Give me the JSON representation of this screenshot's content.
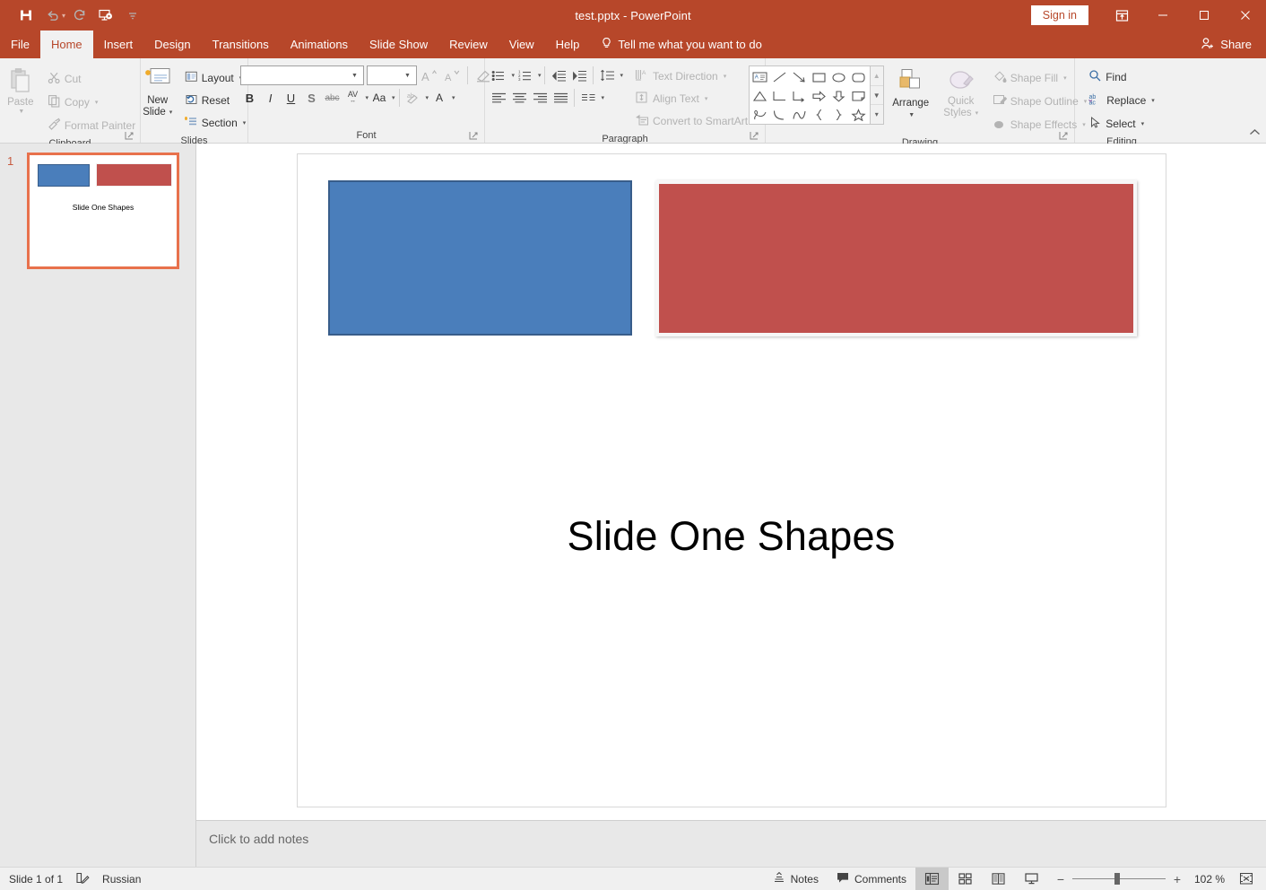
{
  "window": {
    "title": "test.pptx  -  PowerPoint",
    "signin_label": "Sign in",
    "share_label": "Share",
    "accent_color": "#b7472a"
  },
  "quick_access": [
    {
      "name": "save-icon",
      "label": "Save"
    },
    {
      "name": "undo-icon",
      "label": "Undo"
    },
    {
      "name": "redo-icon",
      "label": "Redo"
    },
    {
      "name": "start-from-beginning-icon",
      "label": "Start From Beginning"
    },
    {
      "name": "customize-quick-access-toolbar-icon",
      "label": "Customize Quick Access Toolbar"
    }
  ],
  "window_controls": {
    "ribbon_display_options": "Ribbon Display Options",
    "minimize": "Minimize",
    "restore": "Restore Down",
    "close": "Close"
  },
  "tabs": [
    {
      "label": "File",
      "active": false
    },
    {
      "label": "Home",
      "active": true
    },
    {
      "label": "Insert",
      "active": false
    },
    {
      "label": "Design",
      "active": false
    },
    {
      "label": "Transitions",
      "active": false
    },
    {
      "label": "Animations",
      "active": false
    },
    {
      "label": "Slide Show",
      "active": false
    },
    {
      "label": "Review",
      "active": false
    },
    {
      "label": "View",
      "active": false
    },
    {
      "label": "Help",
      "active": false
    }
  ],
  "tellme": {
    "label": "Tell me what you want to do",
    "icon": "lightbulb-icon"
  },
  "ribbon": {
    "collapse_label": "Collapse the Ribbon",
    "groups": [
      {
        "name": "clipboard",
        "label": "Clipboard",
        "paste_label": "Paste",
        "items": [
          {
            "label": "Cut",
            "icon": "scissors-icon",
            "disabled": true
          },
          {
            "label": "Copy",
            "icon": "copy-icon",
            "disabled": true
          },
          {
            "label": "Format Painter",
            "icon": "paintbrush-icon",
            "disabled": true
          }
        ]
      },
      {
        "name": "slides",
        "label": "Slides",
        "new_slide_line1": "New",
        "new_slide_line2": "Slide",
        "items": [
          {
            "label": "Layout",
            "icon": "layout-icon"
          },
          {
            "label": "Reset",
            "icon": "reset-icon"
          },
          {
            "label": "Section",
            "icon": "section-icon"
          }
        ]
      },
      {
        "name": "font",
        "label": "Font",
        "font_name_value": "",
        "font_name_placeholder": "",
        "font_size_value": "",
        "font_size_placeholder": "",
        "buttons": [
          {
            "label": "B",
            "name": "bold-button"
          },
          {
            "label": "I",
            "name": "italic-button"
          },
          {
            "label": "U",
            "name": "underline-button"
          },
          {
            "label": "S",
            "name": "text-shadow-button"
          },
          {
            "label": "abc",
            "name": "strikethrough-button"
          },
          {
            "label": "AV",
            "name": "character-spacing-button"
          },
          {
            "label": "Aa",
            "name": "change-case-button"
          },
          {
            "label": "A",
            "name": "font-color-button"
          }
        ],
        "increase_font": "Increase Font Size",
        "decrease_font": "Decrease Font Size",
        "clear_formatting": "Clear All Formatting",
        "text_highlight": "Text Highlight Color"
      },
      {
        "name": "paragraph",
        "label": "Paragraph",
        "items": [
          {
            "label": "Text Direction",
            "icon": "text-direction-icon",
            "disabled": true
          },
          {
            "label": "Align Text",
            "icon": "align-text-icon",
            "disabled": true
          },
          {
            "label": "Convert to SmartArt",
            "icon": "smartart-icon",
            "disabled": true
          }
        ],
        "bullets": "Bullets",
        "numbering": "Numbering",
        "decrease_indent": "Decrease List Level",
        "increase_indent": "Increase List Level",
        "line_spacing": "Line Spacing",
        "align_left": "Align Left",
        "align_center": "Center",
        "align_right": "Align Right",
        "justify": "Justify",
        "columns": "Add or Remove Columns"
      },
      {
        "name": "drawing",
        "label": "Drawing",
        "arrange_label": "Arrange",
        "quick_styles_line1": "Quick",
        "quick_styles_line2": "Styles",
        "shapes": [
          "text-box-shape",
          "line-shape",
          "arrow-shape",
          "rectangle-shape",
          "oval-shape",
          "rounded-rectangle-shape",
          "triangle-shape",
          "elbow-connector-shape",
          "elbow-arrow-connector-shape",
          "right-arrow-shape",
          "down-arrow-shape",
          "folded-corner-shape",
          "scribble-shape",
          "arc-shape",
          "curve-shape",
          "left-brace-shape",
          "right-brace-shape",
          "star-shape"
        ],
        "items": [
          {
            "label": "Shape Fill",
            "icon": "shape-fill-icon",
            "disabled": true
          },
          {
            "label": "Shape Outline",
            "icon": "shape-outline-icon",
            "disabled": true
          },
          {
            "label": "Shape Effects",
            "icon": "shape-effects-icon",
            "disabled": true
          }
        ],
        "gallery_up": "Scroll Up",
        "gallery_down": "Scroll Down",
        "gallery_more": "More"
      },
      {
        "name": "editing",
        "label": "Editing",
        "items": [
          {
            "label": "Find",
            "icon": "magnifier-icon"
          },
          {
            "label": "Replace",
            "icon": "replace-icon"
          },
          {
            "label": "Select",
            "icon": "cursor-icon"
          }
        ]
      }
    ]
  },
  "thumbnails": [
    {
      "number": "1",
      "title": "Slide One Shapes",
      "selected": true,
      "shapes": [
        {
          "name": "blue-rectangle",
          "fill": "#4a7ebb",
          "outline": "#385d8a"
        },
        {
          "name": "red-rectangle",
          "fill": "#c0504d",
          "outline": "#f2f2f2"
        }
      ]
    }
  ],
  "slide": {
    "title": "Slide One Shapes",
    "shapes": [
      {
        "name": "blue-rectangle",
        "fill": "#4a7ebb",
        "outline": "#385d8a"
      },
      {
        "name": "red-rectangle",
        "fill": "#c0504d",
        "outline": "#f7f7f7"
      }
    ]
  },
  "notes": {
    "placeholder": "Click to add notes"
  },
  "status": {
    "slide_counter": "Slide 1 of 1",
    "language": "Russian",
    "accessibility_icon": "accessibility-check-icon",
    "notes_label": "Notes",
    "comments_label": "Comments",
    "views": [
      {
        "name": "normal-view",
        "label": "Normal",
        "active": true
      },
      {
        "name": "slide-sorter-view",
        "label": "Slide Sorter",
        "active": false
      },
      {
        "name": "reading-view",
        "label": "Reading View",
        "active": false
      },
      {
        "name": "slide-show-view",
        "label": "Slide Show",
        "active": false
      }
    ],
    "zoom_out": "−",
    "zoom_in": "+",
    "zoom_level": "102 %",
    "fit_label": "Fit slide to current window"
  }
}
